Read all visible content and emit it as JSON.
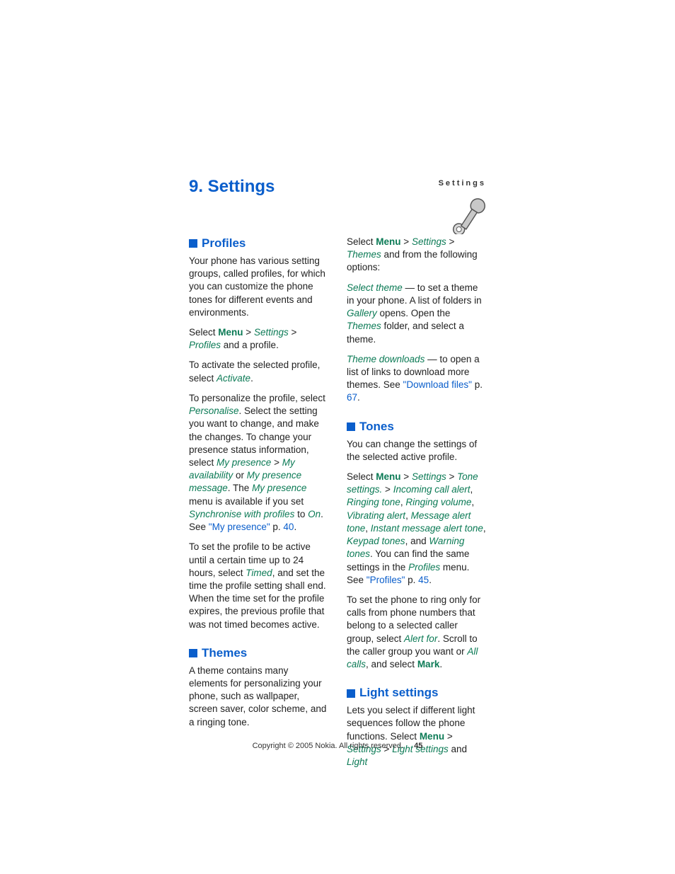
{
  "running_head": "Settings",
  "chapter": "9.  Settings",
  "footer": {
    "copyright": "Copyright © 2005 Nokia. All rights reserved.",
    "page": "45"
  },
  "gt": ">",
  "s": {
    "profiles_h": "Profiles",
    "p1": "Your phone has various setting groups, called profiles, for which you can customize the phone tones for different events and environments.",
    "p2a": "Select ",
    "menu": "Menu",
    "settings": "Settings",
    "profiles": "Profiles",
    "p2b": " and a profile.",
    "p3a": "To activate the selected profile, select ",
    "activate": "Activate",
    "dot": ".",
    "p4a": "To personalize the profile, select ",
    "personalise": "Personalise",
    "p4b": ". Select the setting you want to change, and make the changes. To change your presence status information, select ",
    "mypres": "My presence",
    "myavail": "My availability",
    "or": " or ",
    "mypresmsg": "My presence message",
    "p4c": ". The ",
    "p4d": " menu is available if you set ",
    "syncprof": "Synchronise with profiles",
    "to": " to ",
    "on": "On",
    "p4e": ". See ",
    "link_mypres": "\"My presence\"",
    "p_mypres": " p. ",
    "pg40": "40",
    "p5a": "To set the profile to be active until a certain time up to 24 hours, select ",
    "timed": "Timed",
    "p5b": ", and set the time the profile setting shall end. When the time set for the profile expires, the previous profile that was not timed becomes active.",
    "themes_h": "Themes",
    "t1": "A theme contains many elements for personalizing your phone, such as wallpaper, screen saver, color scheme, and a ringing tone.",
    "t2a": "Select ",
    "themes": "Themes",
    "t2b": " and from the following options:",
    "seltheme": "Select theme",
    "t3a": " — to set a theme in your phone. A list of folders in ",
    "gallery": "Gallery",
    "t3b": " opens. Open the ",
    "t3c": " folder, and select a theme.",
    "themedl": "Theme downloads",
    "t4a": " — to open a list of links to download more themes. See ",
    "link_dl": "\"Download files\"",
    "p_dl": " p. ",
    "pg67": "67",
    "tones_h": "Tones",
    "to1": "You can change the settings of the selected active profile.",
    "tonesettings": "Tone settings.",
    "incoming": "Incoming call alert",
    "ringtone": "Ringing tone",
    "ringvol": "Ringing volume",
    "vibr": "Vibrating alert",
    "msgalert": "Message alert tone",
    "imalert": "Instant message alert tone",
    "keypad": "Keypad tones",
    "and": ", and ",
    "warn": "Warning tones",
    "to2a": ". You can find the same settings in the ",
    "to2b": " menu. See ",
    "link_prof": "\"Profiles\"",
    "p_prof": " p. ",
    "pg45": "45",
    "to3a": "To set the phone to ring only for calls from phone numbers that belong to a selected caller group, select ",
    "alertfor": "Alert for",
    "to3b": ". Scroll to the caller group you want or ",
    "allcalls": "All calls",
    "to3c": ", and select ",
    "mark": "Mark",
    "light_h": "Light settings",
    "l1a": "Lets you select if different light sequences follow the phone functions. Select ",
    "lightset": "Light settings",
    "l_and": " and ",
    "light": "Light"
  }
}
